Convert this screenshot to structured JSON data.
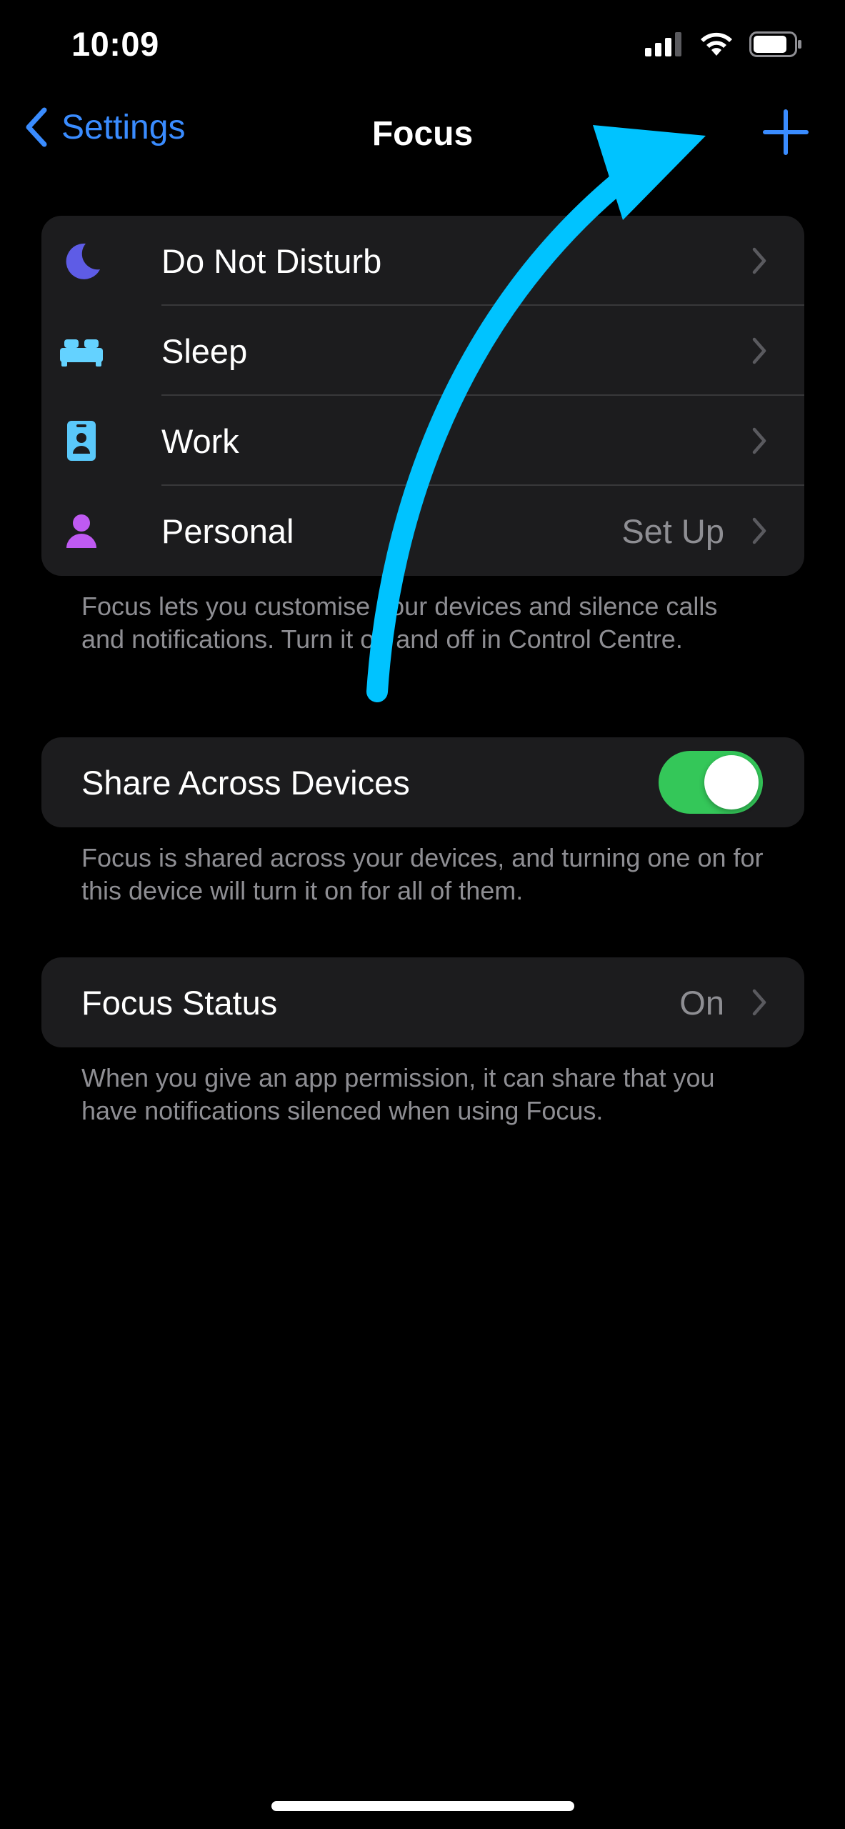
{
  "status_bar": {
    "time": "10:09"
  },
  "nav": {
    "back_label": "Settings",
    "title": "Focus"
  },
  "focus_modes": [
    {
      "label": "Do Not Disturb",
      "icon": "moon-icon",
      "color": "#5e5ce6",
      "value": ""
    },
    {
      "label": "Sleep",
      "icon": "bed-icon",
      "color": "#64d2ff",
      "value": ""
    },
    {
      "label": "Work",
      "icon": "id-badge-icon",
      "color": "#5ac8fa",
      "value": ""
    },
    {
      "label": "Personal",
      "icon": "person-icon",
      "color": "#bf5af2",
      "value": "Set Up"
    }
  ],
  "focus_footer": "Focus lets you customise your devices and silence calls and notifications. Turn it on and off in Control Centre.",
  "share": {
    "label": "Share Across Devices",
    "enabled": true,
    "footer": "Focus is shared across your devices, and turning one on for this device will turn it on for all of them."
  },
  "focus_status": {
    "label": "Focus Status",
    "value": "On",
    "footer": "When you give an app permission, it can share that you have notifications silenced when using Focus."
  },
  "colors": {
    "accent": "#3a8cff",
    "toggle_on": "#34c759",
    "annotation_arrow": "#00c3ff"
  }
}
